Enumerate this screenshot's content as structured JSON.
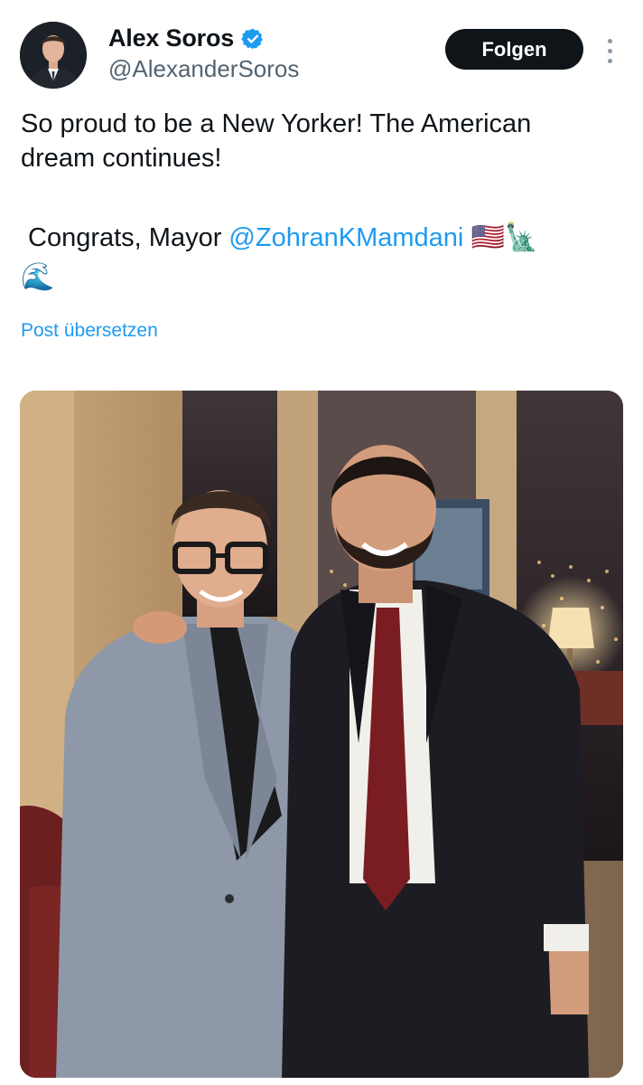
{
  "author": {
    "name": "Alex Soros",
    "handle": "@AlexanderSoros",
    "verified": true
  },
  "actions": {
    "follow_label": "Folgen",
    "more_icon": "more-vertical-icon"
  },
  "post": {
    "line1": "So proud to be a New Yorker! The American",
    "line2": "dream continues!",
    "congrats": "Congrats, Mayor ",
    "mention": "@ZohranKMamdani",
    "emojis": [
      "🇺🇸",
      "🗽",
      "🌊"
    ],
    "translate_label": "Post übersetzen"
  },
  "colors": {
    "link": "#1d9bf0",
    "follow_bg": "#0f1419",
    "verified": "#1d9bf0",
    "secondary_text": "#536471"
  }
}
